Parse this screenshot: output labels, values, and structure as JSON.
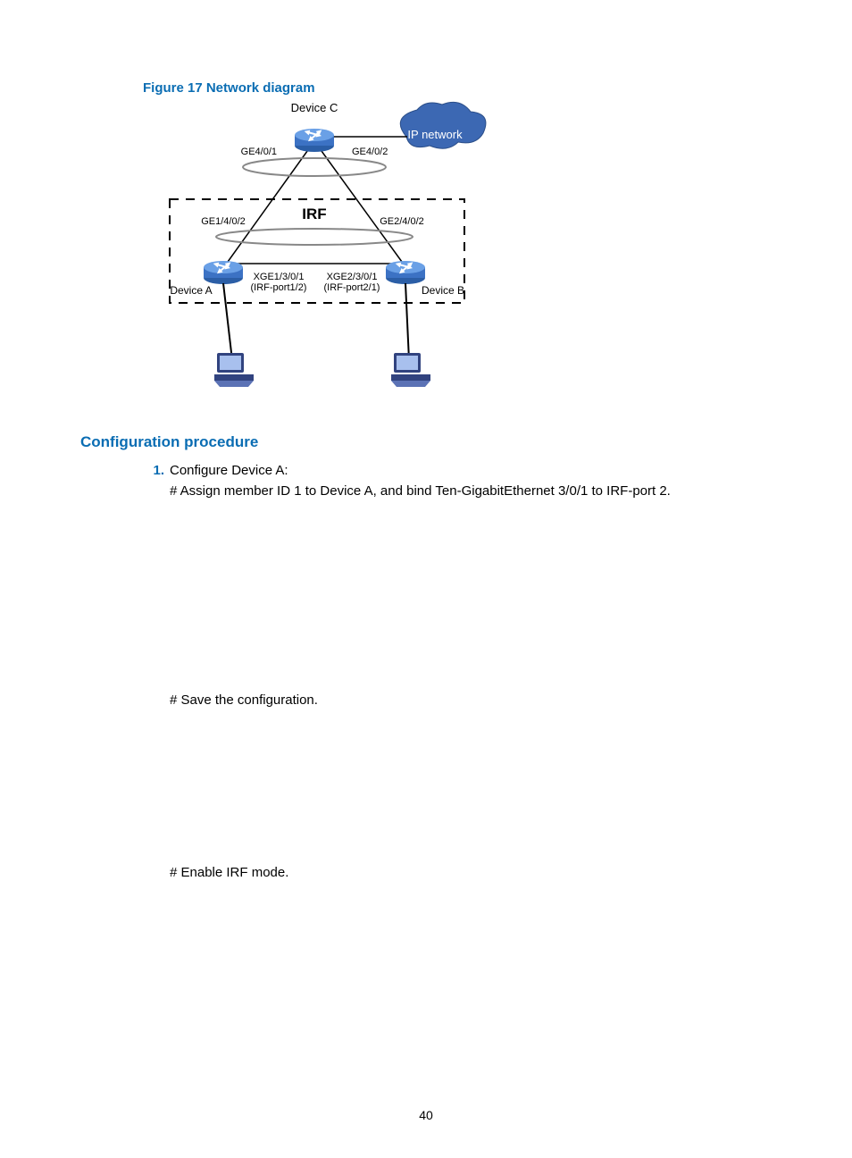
{
  "figure": {
    "title": "Figure 17 Network diagram",
    "labels": {
      "deviceC": "Device C",
      "deviceA": "Device A",
      "deviceB": "Device B",
      "ipNetwork": "IP network",
      "irf": "IRF",
      "ge401": "GE4/0/1",
      "ge402": "GE4/0/2",
      "ge1402": "GE1/4/0/2",
      "ge2402": "GE2/4/0/2",
      "xge1301": "XGE1/3/0/1",
      "irfport12": "(IRF-port1/2)",
      "xge2301": "XGE2/3/0/1",
      "irfport21": "(IRF-port2/1)"
    }
  },
  "section_title": "Configuration procedure",
  "steps": [
    {
      "num": "1.",
      "head": "Configure Device A:",
      "sub": [
        "# Assign member ID 1 to Device A, and bind Ten-GigabitEthernet 3/0/1 to IRF-port 2.",
        "# Save the configuration.",
        "# Enable IRF mode."
      ]
    }
  ],
  "page_number": "40"
}
